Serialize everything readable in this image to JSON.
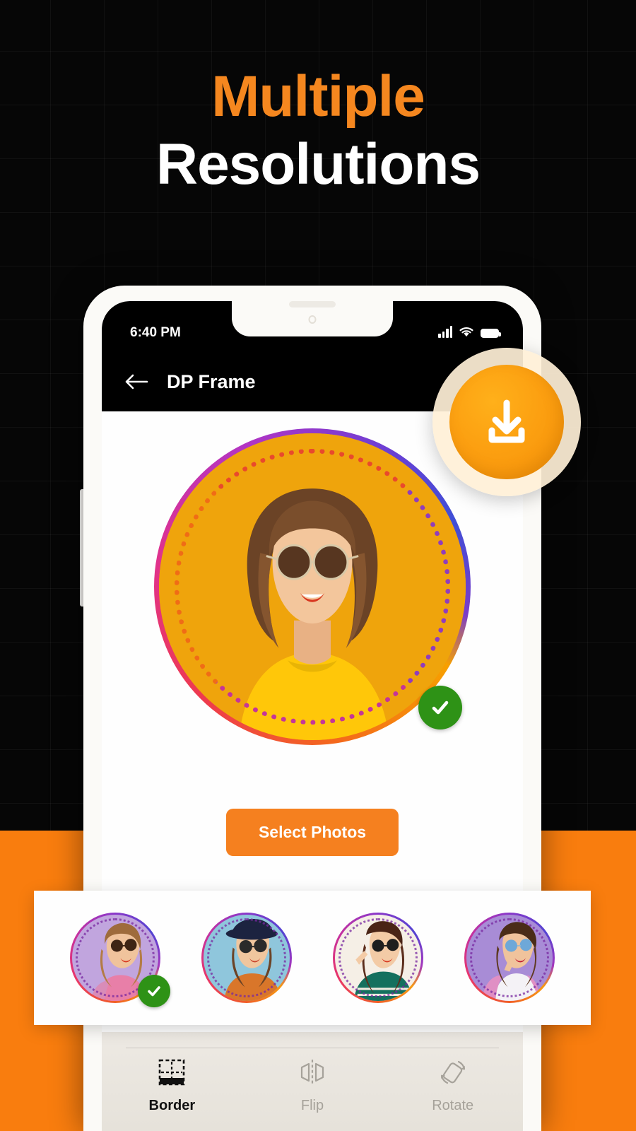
{
  "promo": {
    "headline_line1": "Multiple",
    "headline_line2": "Resolutions",
    "headline_color_1": "#F5871F",
    "headline_color_2": "#FFFFFF",
    "background_color": "#060606",
    "band_color": "#F97D0E"
  },
  "phone": {
    "status_bar": {
      "time": "6:40 PM",
      "signal_icon": "cellular-bars-icon",
      "wifi_icon": "wifi-icon",
      "battery_icon": "battery-full-icon"
    },
    "app_bar": {
      "back_icon": "back-arrow-icon",
      "title": "DP Frame",
      "preview_icon": "eye-icon"
    },
    "fab": {
      "label": "Download",
      "icon": "download-icon",
      "color": "#FCA011"
    },
    "preview": {
      "frame_background": "#EFA40C",
      "selected_badge_icon": "check-icon",
      "selected_badge_color": "#2E9216"
    },
    "select_photos_button": {
      "label": "Select Photos",
      "color": "#F5801F"
    },
    "thumbnails": [
      {
        "id": "thumb-1",
        "background": "#C1A5DE",
        "selected": true,
        "badge_icon": "check-icon"
      },
      {
        "id": "thumb-2",
        "background": "#8FC6DC",
        "selected": false,
        "badge_icon": ""
      },
      {
        "id": "thumb-3",
        "background": "#F5EFE6",
        "selected": false,
        "badge_icon": ""
      },
      {
        "id": "thumb-4",
        "background": "#A88CD6",
        "selected": false,
        "badge_icon": ""
      }
    ],
    "toolbar": [
      {
        "label": "Border",
        "icon": "border-icon",
        "active": true
      },
      {
        "label": "Flip",
        "icon": "flip-icon",
        "active": false
      },
      {
        "label": "Rotate",
        "icon": "rotate-icon",
        "active": false
      }
    ]
  }
}
